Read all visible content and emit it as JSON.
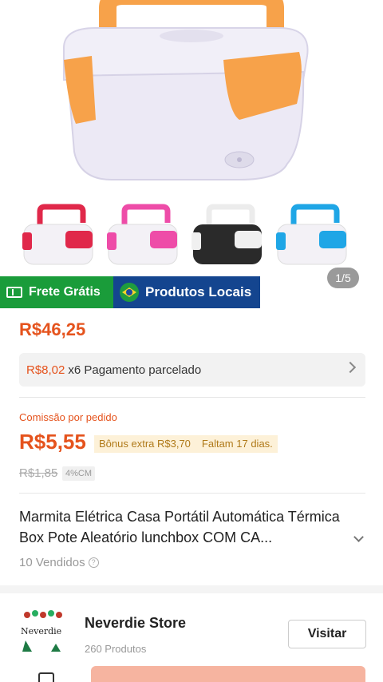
{
  "gallery": {
    "pager": "1/5",
    "thumbs": [
      "red",
      "pink",
      "black",
      "blue"
    ]
  },
  "badges": {
    "frete": "Frete Grátis",
    "locais": "Produtos Locais"
  },
  "price": {
    "main": "R$46,25",
    "installment_amount": "R$8,02",
    "installment_text": "x6 Pagamento parcelado"
  },
  "commission": {
    "label": "Comissão por pedido",
    "value": "R$5,55",
    "bonus": "Bônus extra R$3,70",
    "remaining": "Faltam 17 dias.",
    "old_value": "R$1,85",
    "percent": "4%CM"
  },
  "product": {
    "title": "Marmita Elétrica Casa Portátil Automática Térmica Box Pote Aleatório lunchbox COM CA...",
    "sold": "10 Vendidos"
  },
  "store": {
    "name": "Neverdie Store",
    "products": "260 Produtos",
    "visit": "Visitar",
    "logo_text": "Neverdie"
  },
  "colors": {
    "accent": "#e5531d",
    "frete_bg": "#1a9c3a",
    "locais_bg": "#14458f",
    "orange_handle": "#f7a24a",
    "box_body": "#ece9f5"
  }
}
